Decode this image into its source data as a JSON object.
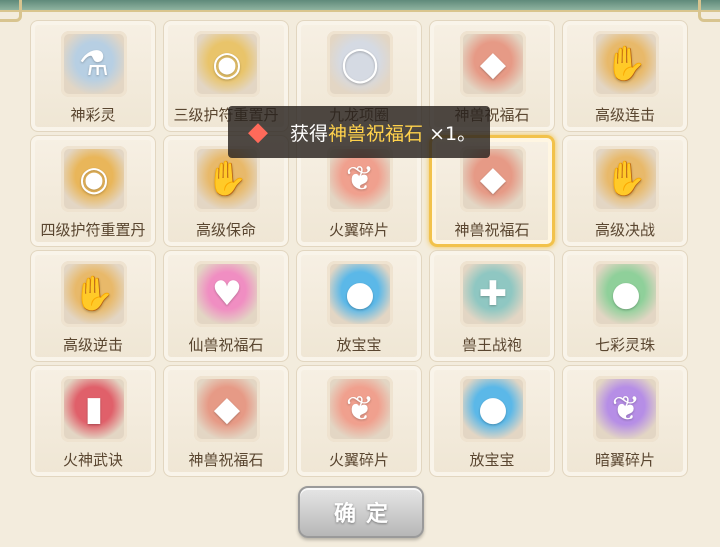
{
  "items": [
    {
      "name": "神彩灵",
      "icon": "magic-potion-icon",
      "glyph": "⚗",
      "bg": "#b7cfe3"
    },
    {
      "name": "三级护符重置丹",
      "icon": "golden-amulet-icon",
      "glyph": "◉",
      "bg": "#e9c46a"
    },
    {
      "name": "九龙项圈",
      "icon": "silver-collar-icon",
      "glyph": "◯",
      "bg": "#d5dae3"
    },
    {
      "name": "神兽祝福石",
      "icon": "red-gem-icon",
      "glyph": "◆",
      "bg": "#e69a86"
    },
    {
      "name": "高级连击",
      "icon": "paw-scroll-icon",
      "glyph": "✋",
      "bg": "#e8b96a"
    },
    {
      "name": "四级护符重置丹",
      "icon": "golden-amulet-icon",
      "glyph": "◉",
      "bg": "#e9b65a"
    },
    {
      "name": "高级保命",
      "icon": "paw-scroll-icon",
      "glyph": "✋",
      "bg": "#e8b96a"
    },
    {
      "name": "火翼碎片",
      "icon": "red-feather-icon",
      "glyph": "❦",
      "bg": "#f0a08e"
    },
    {
      "name": "神兽祝福石",
      "icon": "red-gem-icon",
      "glyph": "◆",
      "bg": "#e69a86"
    },
    {
      "name": "高级决战",
      "icon": "paw-scroll-icon",
      "glyph": "✋",
      "bg": "#e8b96a"
    },
    {
      "name": "高级逆击",
      "icon": "paw-scroll-icon",
      "glyph": "✋",
      "bg": "#e8b96a"
    },
    {
      "name": "仙兽祝福石",
      "icon": "pink-heart-gem-icon",
      "glyph": "♥",
      "bg": "#f08ec2"
    },
    {
      "name": "放宝宝",
      "icon": "blue-bird-avatar-icon",
      "glyph": "●",
      "bg": "#5bb8e8"
    },
    {
      "name": "兽王战袍",
      "icon": "battle-robe-icon",
      "glyph": "✚",
      "bg": "#8fc7c2"
    },
    {
      "name": "七彩灵珠",
      "icon": "rainbow-orb-icon",
      "glyph": "●",
      "bg": "#8fd09a"
    },
    {
      "name": "火神武诀",
      "icon": "red-book-icon",
      "glyph": "▮",
      "bg": "#e0606a"
    },
    {
      "name": "神兽祝福石",
      "icon": "red-gem-icon",
      "glyph": "◆",
      "bg": "#e69a86"
    },
    {
      "name": "火翼碎片",
      "icon": "red-feather-icon",
      "glyph": "❦",
      "bg": "#f0a08e"
    },
    {
      "name": "放宝宝",
      "icon": "blue-bird-avatar-icon",
      "glyph": "●",
      "bg": "#5bb8e8"
    },
    {
      "name": "暗翼碎片",
      "icon": "purple-feather-icon",
      "glyph": "❦",
      "bg": "#b68ee6"
    }
  ],
  "selected_index": 8,
  "toast": {
    "prefix": "获得",
    "item": "神兽祝福石",
    "suffix": " ×1。",
    "icon": "red-gem-icon"
  },
  "confirm_label": "确定",
  "colors": {
    "highlight": "#f2c24b",
    "toast_item": "#ffd24c",
    "text": "#5a4630"
  }
}
